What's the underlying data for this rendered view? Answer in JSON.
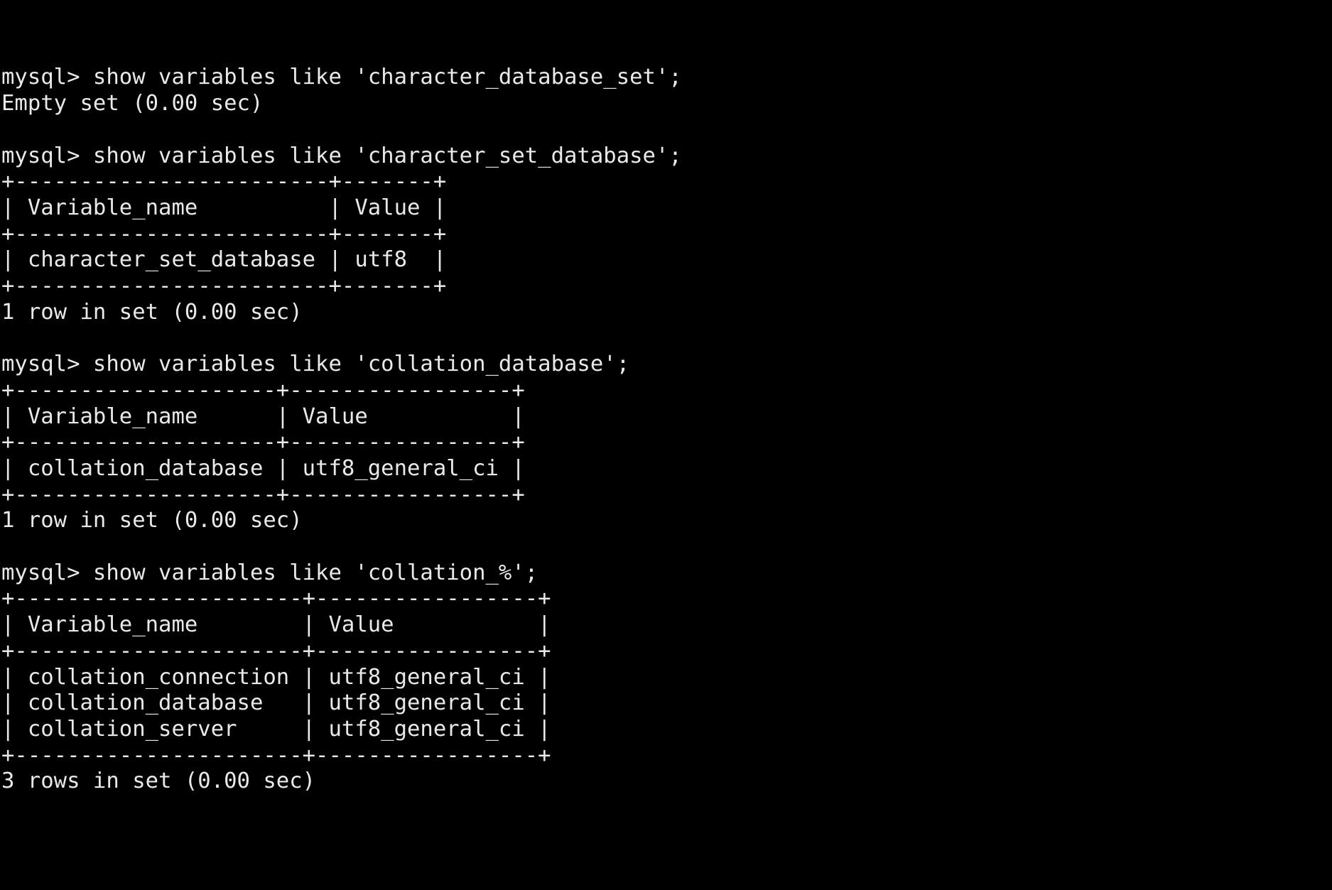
{
  "terminal": {
    "background_color": "#000000",
    "text_color": "#e9e9e9",
    "prompt": "mysql>",
    "blocks": [
      {
        "name": "query-character-database-set",
        "command": "mysql> show variables like 'character_database_set';",
        "result_lines": [
          "Empty set (0.00 sec)"
        ],
        "status": "Empty set (0.00 sec)"
      },
      {
        "name": "query-character-set-database",
        "command": "mysql> show variables like 'character_set_database';",
        "result_lines": [
          "+------------------------+-------+",
          "| Variable_name          | Value |",
          "+------------------------+-------+",
          "| character_set_database | utf8  |",
          "+------------------------+-------+",
          "1 row in set (0.00 sec)"
        ],
        "table": {
          "columns": [
            "Variable_name",
            "Value"
          ],
          "rows": [
            [
              "character_set_database",
              "utf8"
            ]
          ]
        },
        "status": "1 row in set (0.00 sec)"
      },
      {
        "name": "query-collation-database",
        "command": "mysql> show variables like 'collation_database';",
        "result_lines": [
          "+--------------------+-----------------+",
          "| Variable_name      | Value           |",
          "+--------------------+-----------------+",
          "| collation_database | utf8_general_ci |",
          "+--------------------+-----------------+",
          "1 row in set (0.00 sec)"
        ],
        "table": {
          "columns": [
            "Variable_name",
            "Value"
          ],
          "rows": [
            [
              "collation_database",
              "utf8_general_ci"
            ]
          ]
        },
        "status": "1 row in set (0.00 sec)"
      },
      {
        "name": "query-collation-wildcard",
        "command": "mysql> show variables like 'collation_%';",
        "result_lines": [
          "+----------------------+-----------------+",
          "| Variable_name        | Value           |",
          "+----------------------+-----------------+",
          "| collation_connection | utf8_general_ci |",
          "| collation_database   | utf8_general_ci |",
          "| collation_server     | utf8_general_ci |",
          "+----------------------+-----------------+",
          "3 rows in set (0.00 sec)"
        ],
        "table": {
          "columns": [
            "Variable_name",
            "Value"
          ],
          "rows": [
            [
              "collation_connection",
              "utf8_general_ci"
            ],
            [
              "collation_database",
              "utf8_general_ci"
            ],
            [
              "collation_server",
              "utf8_general_ci"
            ]
          ]
        },
        "status": "3 rows in set (0.00 sec)"
      }
    ],
    "screen_text": "mysql> show variables like 'character_database_set';\nEmpty set (0.00 sec)\n\nmysql> show variables like 'character_set_database';\n+------------------------+-------+\n| Variable_name          | Value |\n+------------------------+-------+\n| character_set_database | utf8  |\n+------------------------+-------+\n1 row in set (0.00 sec)\n\nmysql> show variables like 'collation_database';\n+--------------------+-----------------+\n| Variable_name      | Value           |\n+--------------------+-----------------+\n| collation_database | utf8_general_ci |\n+--------------------+-----------------+\n1 row in set (0.00 sec)\n\nmysql> show variables like 'collation_%';\n+----------------------+-----------------+\n| Variable_name        | Value           |\n+----------------------+-----------------+\n| collation_connection | utf8_general_ci |\n| collation_database   | utf8_general_ci |\n| collation_server     | utf8_general_ci |\n+----------------------+-----------------+\n3 rows in set (0.00 sec)"
  }
}
